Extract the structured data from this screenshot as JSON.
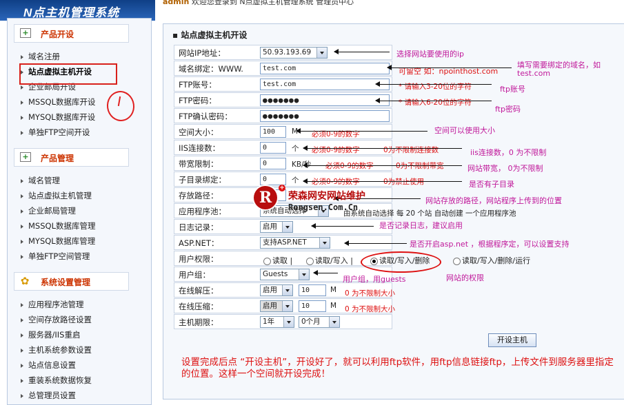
{
  "header": {
    "logo_text": "N点主机管理系统",
    "username": "admin",
    "welcome": "欢迎您登录到 N点虚拟主机管理系统 管理员中心"
  },
  "sidebar": {
    "sections": [
      {
        "title": "产品开设",
        "items": [
          "域名注册",
          "站点虚拟主机开设",
          "企业邮局开设",
          "MSSQL数据库开设",
          "MYSQL数据库开设",
          "单独FTP空间开设"
        ]
      },
      {
        "title": "产品管理",
        "items": [
          "域名管理",
          "站点虚拟主机管理",
          "企业邮局管理",
          "MSSQL数据库管理",
          "MYSQL数据库管理",
          "单独FTP空间管理"
        ]
      },
      {
        "title": "系统设置管理",
        "items": [
          "应用程序池管理",
          "空间存放路径设置",
          "服务器/IIS重启",
          "主机系统参数设置",
          "站点信息设置",
          "重装系统数据恢复",
          "总管理员设置"
        ]
      }
    ]
  },
  "panel": {
    "title": "站点虚拟主机开设",
    "submit_label": "开设主机"
  },
  "form": {
    "ip_label": "网站IP地址：",
    "ip_value": "50.93.193.69",
    "domain_label": "域名绑定：WWW.",
    "domain_value": "test.com",
    "domain_hint": "可留空 如：npointhost.com",
    "ftp_label": "FTP账号：",
    "ftp_value": "test.com",
    "ftp_hint": "* 请输入3-20位的字符",
    "ftppwd_label": "FTP密码：",
    "ftppwd_value": "●●●●●●●",
    "ftppwd_hint": "* 请输入6-20位的字符",
    "ftppwd2_label": "FTP确认密码：",
    "ftppwd2_value": "●●●●●●●",
    "space_label": "空间大小：",
    "space_value": "100",
    "space_unit": "M",
    "space_hint": "必须0-9的数字",
    "iis_label": "IIS连接数：",
    "iis_value": "0",
    "iis_unit": "个",
    "iis_hint1": "必须0-9的数字",
    "iis_hint2": "0为不限制连接数",
    "bw_label": "带宽限制：",
    "bw_value": "0",
    "bw_unit": "KB/秒",
    "bw_hint1": "必须0-9的数字",
    "bw_hint2": "0为不限制带宽",
    "sub_label": "子目录绑定：",
    "sub_value": "0",
    "sub_unit": "个",
    "sub_hint1": "必须0-9的数字",
    "sub_hint2": "0为禁止使用",
    "path_label": "存放路径：",
    "path_value": "Web",
    "pool_label": "应用程序池：",
    "pool_value": "系统自动选择",
    "pool_hint": "由系统自动选择  每 20 个站 自动创建 一个应用程序池",
    "log_label": "日志记录：",
    "log_value": "启用",
    "asp_label": "ASP.NET：",
    "asp_value": "支持ASP.NET",
    "perm_label": "用户权限：",
    "perm_opt1": "读取",
    "perm_opt2": "读取/写入",
    "perm_opt3": "读取/写入/删除",
    "perm_opt4": "读取/写入/删除/运行",
    "group_label": "用户组：",
    "group_value": "Guests",
    "unzip_label": "在线解压：",
    "unzip_value": "启用",
    "unzip_num": "10",
    "unzip_unit": "M",
    "unzip_hint": "0 为不限制大小",
    "zip_label": "在线压缩：",
    "zip_value": "启用",
    "zip_num": "10",
    "zip_unit": "M",
    "zip_hint": "0 为不限制大小",
    "period_label": "主机期限：",
    "period_year": "1年",
    "period_month": "0个月"
  },
  "annotations": {
    "ip": "选择网站要使用的ip",
    "domain": "填写需要绑定的域名，如test.com",
    "ftp": "ftp账号",
    "ftppwd": "ftp密码",
    "space": "空间可以使用大小",
    "iis": "iis连接数，0 为不限制",
    "bw": "网站带宽， 0为不限制",
    "sub": "是否有子目录",
    "path": "网站存放的路径，网站程序上传到的位置",
    "log": "是否记录日志，建议启用",
    "asp": "是否开启asp.net  ，根据程序定，可以设置支持",
    "group": "用户组，用guests",
    "perm": "网站的权限",
    "bottom": "设置完成后点 “开设主机”，开设好了，就可以利用ftp软件，用ftp信息链接ftp，上传文件到服务器里指定的位置。这样一个空间就开设完成！"
  },
  "watermark": {
    "cn": "荣森网安网站维护",
    "en": "Rongsen.Com.Cn",
    "logo_letter": "R"
  },
  "colors": {
    "annotation_red": "#dd1111",
    "annotation_magenta": "#c0189a",
    "sidebar_title": "#cc3300"
  }
}
